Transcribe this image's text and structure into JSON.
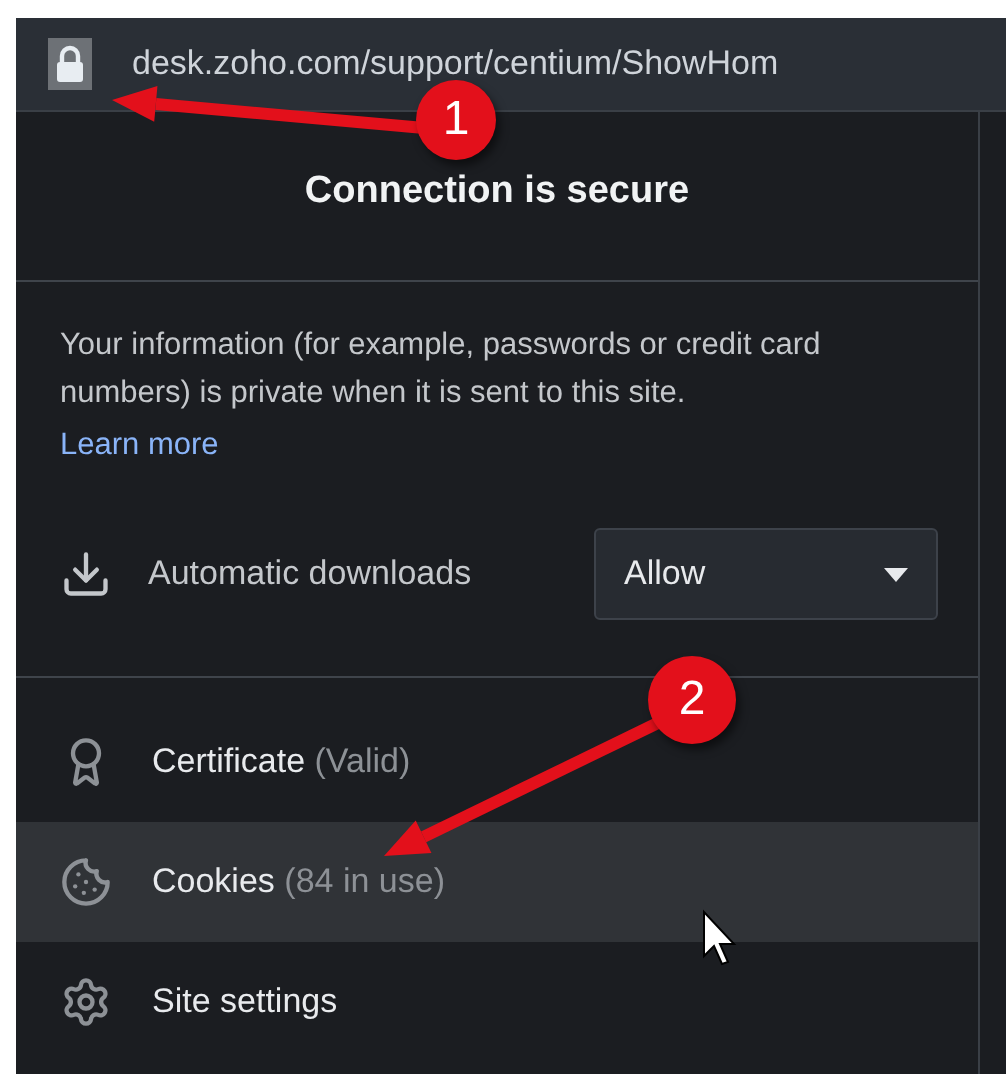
{
  "address_bar": {
    "url": "desk.zoho.com/support/centium/ShowHom"
  },
  "popup": {
    "title": "Connection is secure",
    "info": "Your information (for example, passwords or credit card numbers) is private when it is sent to this site.",
    "learn_more": "Learn more",
    "permissions": [
      {
        "label": "Automatic downloads",
        "value": "Allow"
      }
    ],
    "items": [
      {
        "kind": "certificate",
        "label": "Certificate",
        "detail": "(Valid)",
        "hovered": false
      },
      {
        "kind": "cookies",
        "label": "Cookies",
        "detail": "(84 in use)",
        "hovered": true
      },
      {
        "kind": "settings",
        "label": "Site settings",
        "hovered": false
      }
    ]
  },
  "annotations": [
    {
      "number": "1"
    },
    {
      "number": "2"
    }
  ]
}
